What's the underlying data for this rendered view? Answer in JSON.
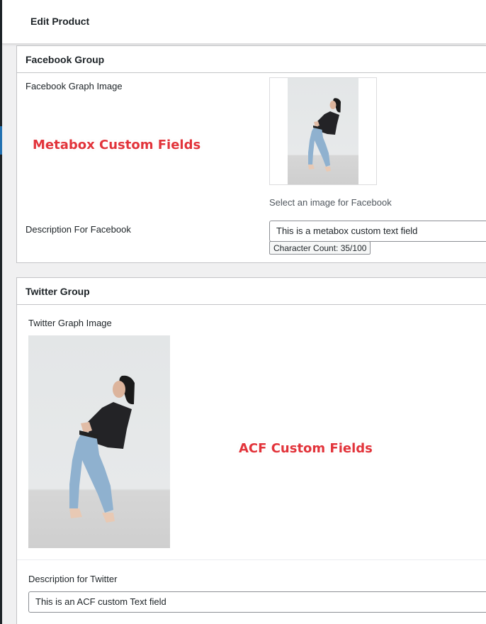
{
  "topbar": {
    "title": "Edit Product"
  },
  "facebook_group": {
    "title": "Facebook Group",
    "image_label": "Facebook Graph Image",
    "image_hint": "Select an image for Facebook",
    "description_label": "Description For Facebook",
    "description_value": "This is a metabox custom text field",
    "char_count": "Character Count: 35/100"
  },
  "twitter_group": {
    "title": "Twitter Group",
    "image_label": "Twitter Graph Image",
    "description_label": "Description for Twitter",
    "description_value": "This is an ACF custom Text field"
  },
  "annotations": {
    "metabox": "Metabox Custom Fields",
    "acf": "ACF Custom Fields",
    "color": "#e2343b"
  },
  "colors": {
    "accent": "#2271b1",
    "panel_border": "#c3c4c7",
    "background": "#f0f0f1"
  }
}
